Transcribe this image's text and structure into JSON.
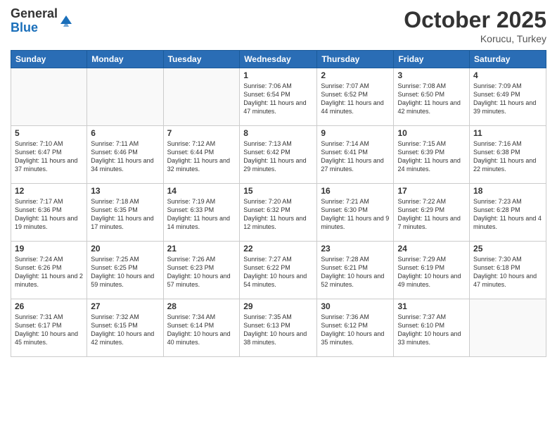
{
  "header": {
    "logo_general": "General",
    "logo_blue": "Blue",
    "month_title": "October 2025",
    "location": "Korucu, Turkey"
  },
  "weekdays": [
    "Sunday",
    "Monday",
    "Tuesday",
    "Wednesday",
    "Thursday",
    "Friday",
    "Saturday"
  ],
  "weeks": [
    [
      {
        "day": null,
        "info": null
      },
      {
        "day": null,
        "info": null
      },
      {
        "day": null,
        "info": null
      },
      {
        "day": "1",
        "info": "Sunrise: 7:06 AM\nSunset: 6:54 PM\nDaylight: 11 hours and 47 minutes."
      },
      {
        "day": "2",
        "info": "Sunrise: 7:07 AM\nSunset: 6:52 PM\nDaylight: 11 hours and 44 minutes."
      },
      {
        "day": "3",
        "info": "Sunrise: 7:08 AM\nSunset: 6:50 PM\nDaylight: 11 hours and 42 minutes."
      },
      {
        "day": "4",
        "info": "Sunrise: 7:09 AM\nSunset: 6:49 PM\nDaylight: 11 hours and 39 minutes."
      }
    ],
    [
      {
        "day": "5",
        "info": "Sunrise: 7:10 AM\nSunset: 6:47 PM\nDaylight: 11 hours and 37 minutes."
      },
      {
        "day": "6",
        "info": "Sunrise: 7:11 AM\nSunset: 6:46 PM\nDaylight: 11 hours and 34 minutes."
      },
      {
        "day": "7",
        "info": "Sunrise: 7:12 AM\nSunset: 6:44 PM\nDaylight: 11 hours and 32 minutes."
      },
      {
        "day": "8",
        "info": "Sunrise: 7:13 AM\nSunset: 6:42 PM\nDaylight: 11 hours and 29 minutes."
      },
      {
        "day": "9",
        "info": "Sunrise: 7:14 AM\nSunset: 6:41 PM\nDaylight: 11 hours and 27 minutes."
      },
      {
        "day": "10",
        "info": "Sunrise: 7:15 AM\nSunset: 6:39 PM\nDaylight: 11 hours and 24 minutes."
      },
      {
        "day": "11",
        "info": "Sunrise: 7:16 AM\nSunset: 6:38 PM\nDaylight: 11 hours and 22 minutes."
      }
    ],
    [
      {
        "day": "12",
        "info": "Sunrise: 7:17 AM\nSunset: 6:36 PM\nDaylight: 11 hours and 19 minutes."
      },
      {
        "day": "13",
        "info": "Sunrise: 7:18 AM\nSunset: 6:35 PM\nDaylight: 11 hours and 17 minutes."
      },
      {
        "day": "14",
        "info": "Sunrise: 7:19 AM\nSunset: 6:33 PM\nDaylight: 11 hours and 14 minutes."
      },
      {
        "day": "15",
        "info": "Sunrise: 7:20 AM\nSunset: 6:32 PM\nDaylight: 11 hours and 12 minutes."
      },
      {
        "day": "16",
        "info": "Sunrise: 7:21 AM\nSunset: 6:30 PM\nDaylight: 11 hours and 9 minutes."
      },
      {
        "day": "17",
        "info": "Sunrise: 7:22 AM\nSunset: 6:29 PM\nDaylight: 11 hours and 7 minutes."
      },
      {
        "day": "18",
        "info": "Sunrise: 7:23 AM\nSunset: 6:28 PM\nDaylight: 11 hours and 4 minutes."
      }
    ],
    [
      {
        "day": "19",
        "info": "Sunrise: 7:24 AM\nSunset: 6:26 PM\nDaylight: 11 hours and 2 minutes."
      },
      {
        "day": "20",
        "info": "Sunrise: 7:25 AM\nSunset: 6:25 PM\nDaylight: 10 hours and 59 minutes."
      },
      {
        "day": "21",
        "info": "Sunrise: 7:26 AM\nSunset: 6:23 PM\nDaylight: 10 hours and 57 minutes."
      },
      {
        "day": "22",
        "info": "Sunrise: 7:27 AM\nSunset: 6:22 PM\nDaylight: 10 hours and 54 minutes."
      },
      {
        "day": "23",
        "info": "Sunrise: 7:28 AM\nSunset: 6:21 PM\nDaylight: 10 hours and 52 minutes."
      },
      {
        "day": "24",
        "info": "Sunrise: 7:29 AM\nSunset: 6:19 PM\nDaylight: 10 hours and 49 minutes."
      },
      {
        "day": "25",
        "info": "Sunrise: 7:30 AM\nSunset: 6:18 PM\nDaylight: 10 hours and 47 minutes."
      }
    ],
    [
      {
        "day": "26",
        "info": "Sunrise: 7:31 AM\nSunset: 6:17 PM\nDaylight: 10 hours and 45 minutes."
      },
      {
        "day": "27",
        "info": "Sunrise: 7:32 AM\nSunset: 6:15 PM\nDaylight: 10 hours and 42 minutes."
      },
      {
        "day": "28",
        "info": "Sunrise: 7:34 AM\nSunset: 6:14 PM\nDaylight: 10 hours and 40 minutes."
      },
      {
        "day": "29",
        "info": "Sunrise: 7:35 AM\nSunset: 6:13 PM\nDaylight: 10 hours and 38 minutes."
      },
      {
        "day": "30",
        "info": "Sunrise: 7:36 AM\nSunset: 6:12 PM\nDaylight: 10 hours and 35 minutes."
      },
      {
        "day": "31",
        "info": "Sunrise: 7:37 AM\nSunset: 6:10 PM\nDaylight: 10 hours and 33 minutes."
      },
      {
        "day": null,
        "info": null
      }
    ]
  ]
}
